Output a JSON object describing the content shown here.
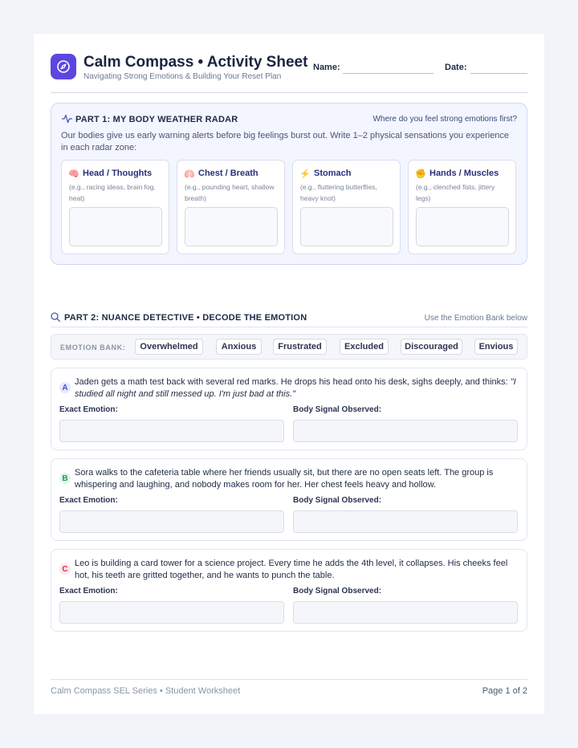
{
  "header": {
    "title": "Calm Compass • Activity Sheet",
    "subtitle": "Navigating Strong Emotions & Building Your Reset Plan",
    "name_label": "Name:",
    "date_label": "Date:",
    "logo_icon": "compass-icon",
    "accent": "#5b47e0"
  },
  "part1": {
    "title": "PART 1: MY BODY WEATHER RADAR",
    "icon": "pulse-icon",
    "prompt": "Where do you feel strong emotions first?",
    "intro": "Our bodies give us early warning alerts before big feelings burst out. Write 1–2 physical sensations you experience in each radar zone:",
    "zones": [
      {
        "emoji": "🧠",
        "name": "Head / Thoughts",
        "hint": "(e.g., racing ideas, brain fog, heat)"
      },
      {
        "emoji": "🫁",
        "name": "Chest / Breath",
        "hint": "(e.g., pounding heart, shallow breath)"
      },
      {
        "emoji": "⚡",
        "name": "Stomach",
        "hint": "(e.g., fluttering butterflies, heavy knot)"
      },
      {
        "emoji": "✊",
        "name": "Hands / Muscles",
        "hint": "(e.g., clenched fists, jittery legs)"
      }
    ]
  },
  "part2": {
    "title": "PART 2: NUANCE DETECTIVE • DECODE THE EMOTION",
    "icon": "search-icon",
    "hint": "Use the Emotion Bank below",
    "bank_label": "EMOTION BANK:",
    "bank": [
      "Overwhelmed",
      "Anxious",
      "Frustrated",
      "Excluded",
      "Discouraged",
      "Envious"
    ],
    "emotion_label": "Exact Emotion:",
    "signal_label": "Body Signal Observed:",
    "scenarios": [
      {
        "letter": "A",
        "text": "Jaden gets a math test back with several red marks. He drops his head onto his desk, sighs deeply, and thinks: ",
        "quote": "\"I studied all night and still messed up. I'm just bad at this.\"",
        "badge_bg": "#e6e9ff",
        "badge_fg": "#4b4fc9"
      },
      {
        "letter": "B",
        "text": "Sora walks to the cafeteria table where her friends usually sit, but there are no open seats left. The group is whispering and laughing, and nobody makes room for her. Her chest feels heavy and hollow.",
        "quote": "",
        "badge_bg": "#e3f6ec",
        "badge_fg": "#1f9a5c"
      },
      {
        "letter": "C",
        "text": "Leo is building a card tower for a science project. Every time he adds the 4th level, it collapses. His cheeks feel hot, his teeth are gritted together, and he wants to punch the table.",
        "quote": "",
        "badge_bg": "#fde7ea",
        "badge_fg": "#d0334a"
      }
    ]
  },
  "footer": {
    "series": "Calm Compass SEL Series • Student Worksheet",
    "page": "Page 1 of 2"
  }
}
